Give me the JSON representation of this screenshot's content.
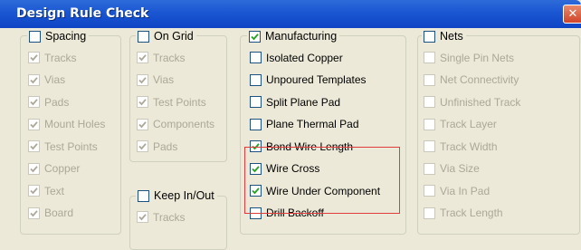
{
  "window": {
    "title": "Design Rule Check",
    "close_glyph": "✕"
  },
  "groups": {
    "spacing": {
      "legend": "Spacing",
      "checked": false,
      "items": [
        {
          "label": "Tracks",
          "checked": true
        },
        {
          "label": "Vias",
          "checked": true
        },
        {
          "label": "Pads",
          "checked": true
        },
        {
          "label": "Mount Holes",
          "checked": true
        },
        {
          "label": "Test Points",
          "checked": true
        },
        {
          "label": "Copper",
          "checked": true
        },
        {
          "label": "Text",
          "checked": true
        },
        {
          "label": "Board",
          "checked": true
        }
      ]
    },
    "on_grid": {
      "legend": "On Grid",
      "checked": false,
      "items": [
        {
          "label": "Tracks",
          "checked": true
        },
        {
          "label": "Vias",
          "checked": true
        },
        {
          "label": "Test Points",
          "checked": true
        },
        {
          "label": "Components",
          "checked": true
        },
        {
          "label": "Pads",
          "checked": true
        }
      ]
    },
    "keep_in_out": {
      "legend": "Keep In/Out",
      "checked": false,
      "items": [
        {
          "label": "Tracks",
          "checked": true
        }
      ]
    },
    "manufacturing": {
      "legend": "Manufacturing",
      "checked": true,
      "items": [
        {
          "label": "Isolated Copper",
          "checked": false
        },
        {
          "label": "Unpoured Templates",
          "checked": false
        },
        {
          "label": "Split Plane Pad",
          "checked": false
        },
        {
          "label": "Plane Thermal Pad",
          "checked": false
        },
        {
          "label": "Bond Wire Length",
          "checked": true
        },
        {
          "label": "Wire Cross",
          "checked": true
        },
        {
          "label": "Wire Under Component",
          "checked": true
        },
        {
          "label": "Drill Backoff",
          "checked": false
        }
      ]
    },
    "nets": {
      "legend": "Nets",
      "checked": false,
      "items": [
        {
          "label": "Single Pin Nets",
          "checked": false
        },
        {
          "label": "Net Connectivity",
          "checked": false
        },
        {
          "label": "Unfinished Track",
          "checked": false
        },
        {
          "label": "Track Layer",
          "checked": false
        },
        {
          "label": "Track Width",
          "checked": false
        },
        {
          "label": "Via Size",
          "checked": false
        },
        {
          "label": "Via In Pad",
          "checked": false
        },
        {
          "label": "Track Length",
          "checked": false
        }
      ]
    }
  },
  "colors": {
    "titlebar": "#0f45c4",
    "highlight_box": "#e03c3c",
    "check_enabled": "#21a121",
    "check_disabled": "#aca899"
  }
}
